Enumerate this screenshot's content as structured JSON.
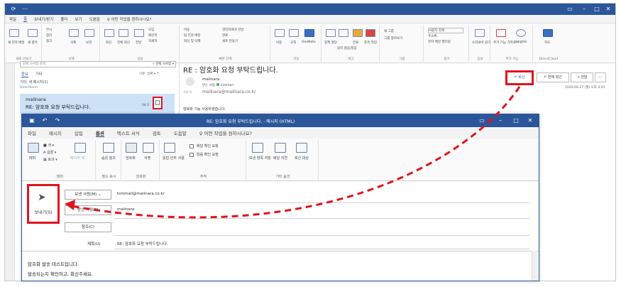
{
  "main_window": {
    "tabs": [
      "파일",
      "홈",
      "보내기/받기",
      "폴더",
      "보기",
      "도움말"
    ],
    "tell_me": "어떤 작업을 원하시나요?",
    "ribbon_groups": [
      "새로 만들기",
      "삭제",
      "응답",
      "빠른 단계",
      "이동",
      "태그",
      "그룹",
      "찾기",
      "음성",
      "추가 기능",
      "DirectCloud"
    ],
    "ribbon_labels": {
      "new_mail": "새 전자 메일",
      "new_items": "새 항목",
      "ignore": "무시",
      "cleanup": "정리",
      "junk": "정크",
      "delete": "삭제",
      "archive": "보관",
      "reply": "회신",
      "reply_all": "전체 회신",
      "forward": "전달",
      "meeting": "모임",
      "im": "메신저",
      "more": "자세히",
      "move_to": "이동",
      "to_manager": "관리자에게 전달",
      "team_email": "팀 전자 메일",
      "done": "완료",
      "reply_delete": "회신 및 삭제",
      "create_new": "새로 만들기",
      "move": "이동",
      "rules": "규칙",
      "onenote": "OneNote",
      "assign_policy": "정책 할당",
      "unread": "읽지 않음/읽음",
      "categorize": "분류",
      "follow_up": "후속 작업",
      "new_group": "새 그룹",
      "browse_groups": "그룹 찾아보기",
      "search_people": "사용자 검색",
      "address_book": "주소록",
      "filter_email": "전자 메일 필터링",
      "read_aloud": "소리내어 읽기",
      "get_addins": "추가 기능 가져오기",
      "insights": "Insights",
      "directcloud": "지도"
    },
    "search_placeholder": "현재 사서함 검색",
    "search_scope": "현재 사서함",
    "filter_focused": "중요",
    "filter_other": "기타",
    "sort_label": "기준: 날짜",
    "other_item": {
      "line1": "기타: 새 메시지(1)",
      "line2": "DirectSend"
    },
    "selected_item": {
      "sender": "mailnara",
      "subject": "RE: 암호화 요청 부탁드립니다.",
      "date": "04-2"
    },
    "reading": {
      "subject": "RE : 암호화 요청 부탁드립니다.",
      "sender": "mailnara",
      "to_label": "받는 사람",
      "to_name": "kimmail",
      "address": "mailnara@mailnara.co.kr",
      "addr_label": "서명 %",
      "body": "암호화 기능 사용하겠습니다.",
      "reply": "회신",
      "reply_all": "전체 회신",
      "forward": "전달",
      "more": "...",
      "date": "2020-04-27 (월) 오후 4:01"
    }
  },
  "compose": {
    "title": "RE: 암호화 요청 부탁드립니다. - 메시지 (HTML)",
    "tabs": [
      "파일",
      "메시지",
      "삽입",
      "옵션",
      "텍스트 서식",
      "검토",
      "도움말"
    ],
    "active_tab": "옵션",
    "tell_me": "어떤 작업을 원하시나요?",
    "groups": {
      "theme": "테마",
      "show_fields": "필드 표시",
      "encrypt": "암호화",
      "tracking": "추적",
      "more_options": "기타 옵션"
    },
    "ribbon": {
      "theme": "테마",
      "colors": "색",
      "fonts": "글꼴",
      "effects": "효과",
      "page_color": "페이지 색",
      "bcc": "숨은 참조",
      "encrypt": "암호화",
      "sign": "서명",
      "use_voting": "응답 단추 사용",
      "request_delivery": "배달 확인 요청",
      "request_read": "읽음 확인 요청",
      "save_sent": "보낸 항목 저장",
      "delay": "배달 지연",
      "direct_replies": "회신 대상"
    },
    "send_label": "보내기(S)",
    "from_btn": "보낸 사람(M)",
    "from_value": "kimmail@mailnara.co.kr",
    "to_btn": "받는 사람(T)",
    "to_value": "mailnara",
    "cc_btn": "참조(C)",
    "subject_label": "제목(U)",
    "subject_value": "RE: 암호화 요청 부탁드립니다.",
    "body_line1": "암호화 발송 테스트입니다.",
    "body_line2": "발송되는지 확인하고, 회신주세요."
  },
  "colors": {
    "title_blue": "#2b579a",
    "highlight_red": "#e0141e",
    "selected_row": "#cde2f7"
  }
}
